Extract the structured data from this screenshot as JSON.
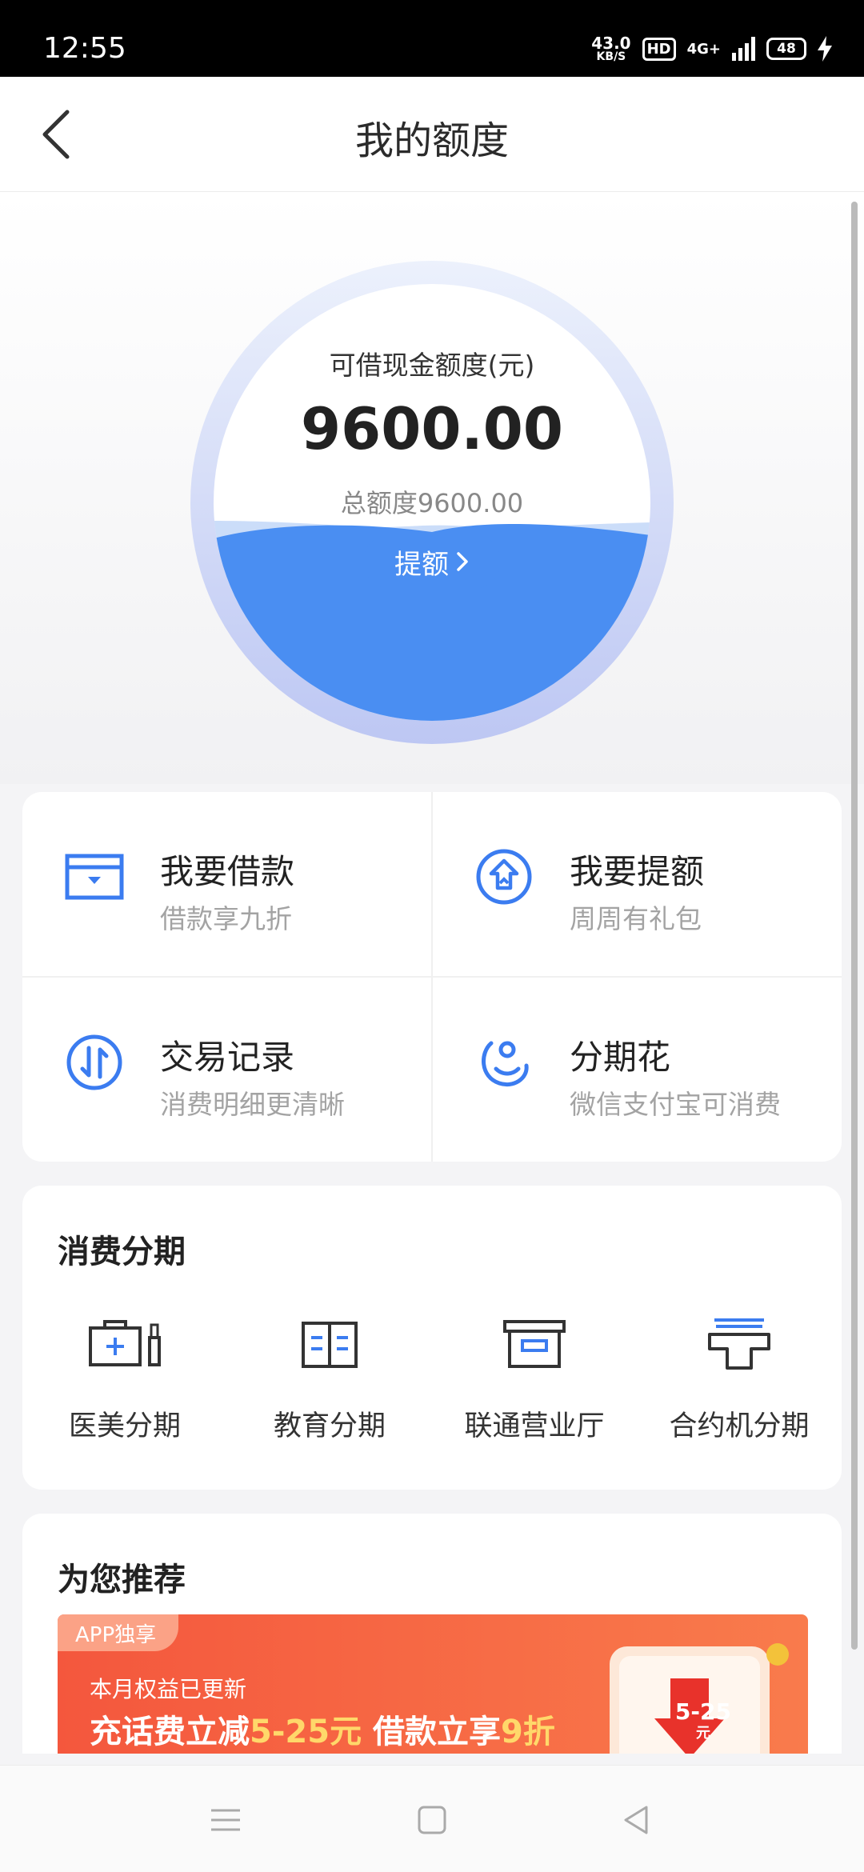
{
  "status_bar": {
    "time": "12:55",
    "net_speed": "43.0",
    "net_speed_unit": "KB/S",
    "hd": "HD",
    "network": "4G+",
    "battery": "48"
  },
  "header": {
    "title": "我的额度"
  },
  "credit": {
    "label": "可借现金额度(元)",
    "amount": "9600.00",
    "total": "总额度9600.00",
    "raise_button": "提额",
    "colors": {
      "accent": "#4a8ef2",
      "wave": "#4a8ef2"
    }
  },
  "quick_actions": [
    {
      "title": "我要借款",
      "subtitle": "借款享九折",
      "icon": "wallet-icon"
    },
    {
      "title": "我要提额",
      "subtitle": "周周有礼包",
      "icon": "raise-limit-icon"
    },
    {
      "title": "交易记录",
      "subtitle": "消费明细更清晰",
      "icon": "transactions-icon"
    },
    {
      "title": "分期花",
      "subtitle": "微信支付宝可消费",
      "icon": "installment-spend-icon"
    }
  ],
  "installment": {
    "title": "消费分期",
    "items": [
      {
        "label": "医美分期",
        "icon": "medical-beauty-icon"
      },
      {
        "label": "教育分期",
        "icon": "education-book-icon"
      },
      {
        "label": "联通营业厅",
        "icon": "store-box-icon"
      },
      {
        "label": "合约机分期",
        "icon": "contract-phone-icon"
      }
    ]
  },
  "recommend": {
    "title": "为您推荐",
    "banner": {
      "badge": "APP独享",
      "subtitle": "本月权益已更新",
      "text_a": "充话费立减",
      "text_b": "5-25元",
      "text_c": " 借款立享",
      "text_d": "9折",
      "coupon_value": "5-25",
      "coupon_unit": "元"
    }
  },
  "nav": {
    "menu": "menu-icon",
    "home": "home-icon",
    "back": "back-icon"
  }
}
